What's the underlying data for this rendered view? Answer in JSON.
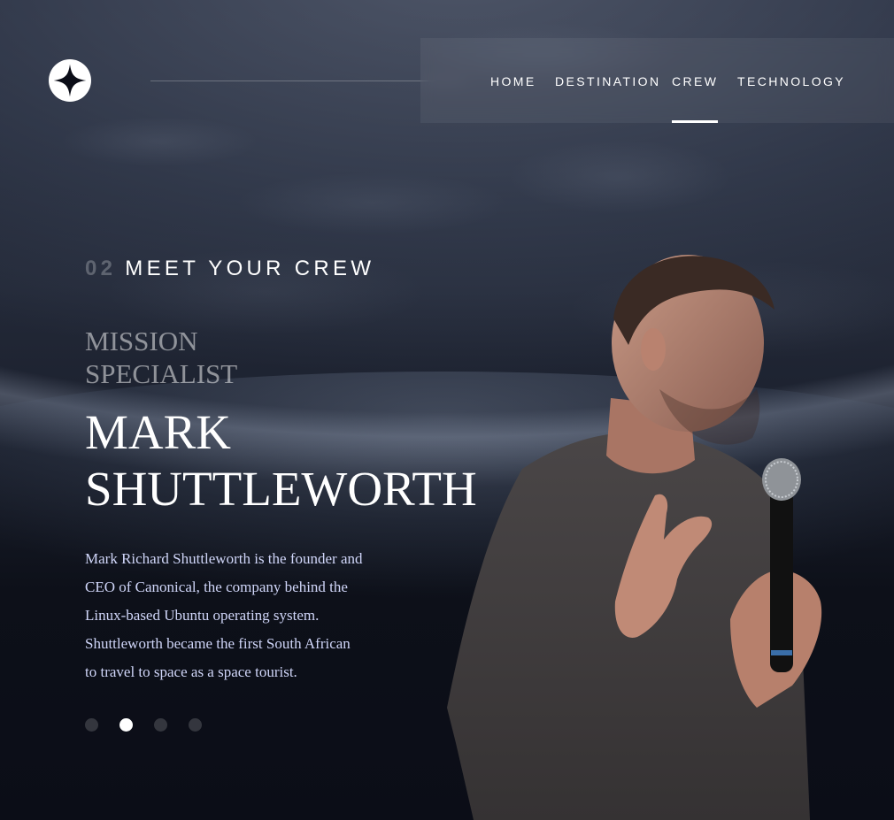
{
  "header": {
    "logo_icon": "star-logo-icon",
    "nav": [
      {
        "label": "HOME",
        "active": false
      },
      {
        "label": "DESTINATION",
        "active": false
      },
      {
        "label": "CREW",
        "active": true
      },
      {
        "label": "TECHNOLOGY",
        "active": false
      }
    ]
  },
  "main": {
    "section_number": "02",
    "section_title": "MEET YOUR CREW",
    "crew_member": {
      "role": "MISSION SPECIALIST",
      "name": "MARK SHUTTLEWORTH",
      "bio": "Mark Richard Shuttleworth is the founder and CEO of Canonical, the company behind the Linux-based Ubuntu operating system. Shuttleworth became the first South African to travel to space as a space tourist.",
      "image_alt": "Mark Shuttleworth holding a microphone"
    },
    "slider": {
      "count": 4,
      "active_index": 1
    }
  },
  "colors": {
    "background": "#0b0d17",
    "text_primary": "#ffffff",
    "text_secondary": "#d0d6f9"
  }
}
